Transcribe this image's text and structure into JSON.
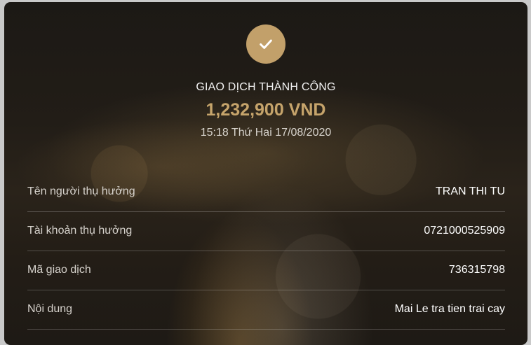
{
  "status": {
    "icon": "check-icon",
    "title": "GIAO DỊCH THÀNH CÔNG",
    "amount": "1,232,900 VND",
    "datetime": "15:18 Thứ Hai 17/08/2020",
    "accent_color": "#c2a06a"
  },
  "details": [
    {
      "label": "Tên người thụ hưởng",
      "value": "TRAN THI TU"
    },
    {
      "label": "Tài khoản thụ hưởng",
      "value": "0721000525909"
    },
    {
      "label": "Mã giao dịch",
      "value": "736315798"
    },
    {
      "label": "Nội dung",
      "value": "Mai Le tra tien trai cay"
    }
  ]
}
